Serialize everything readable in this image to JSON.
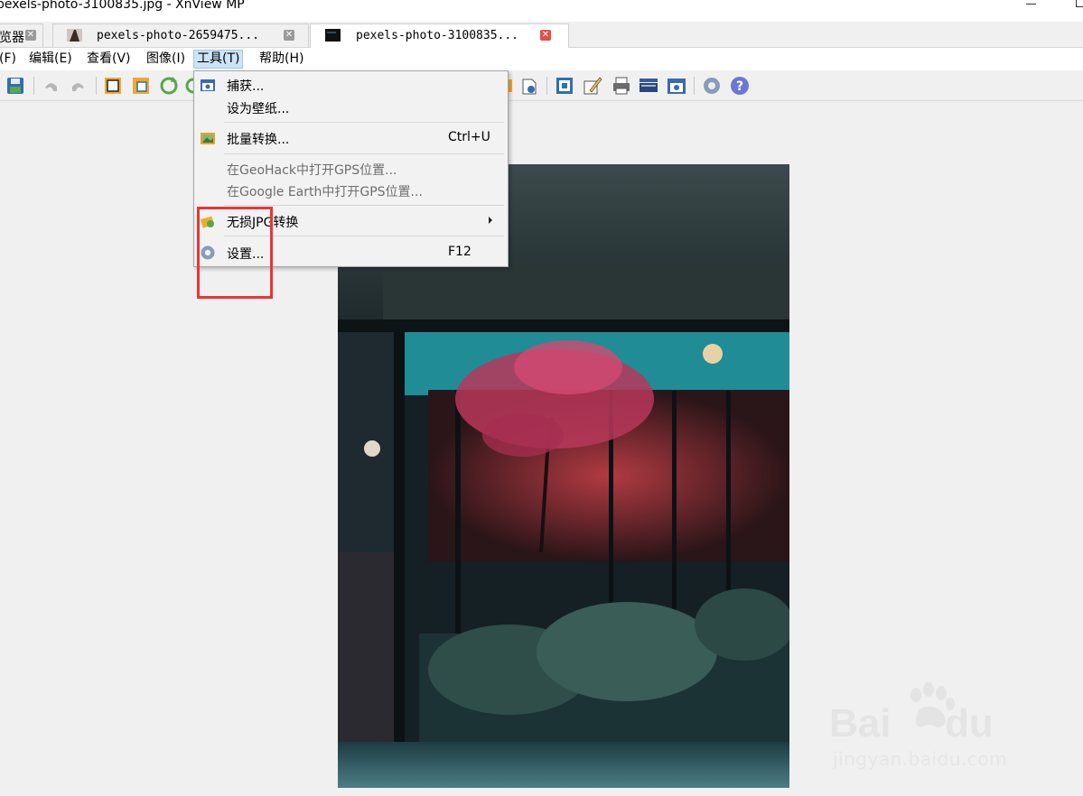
{
  "window": {
    "title": "pexels-photo-3100835.jpg - XnView MP"
  },
  "tabs": [
    {
      "label": "览器",
      "active": false
    },
    {
      "label": "pexels-photo-2659475...",
      "active": false
    },
    {
      "label": "pexels-photo-3100835...",
      "active": true
    }
  ],
  "menu": {
    "items": [
      "(F)",
      "编辑(E)",
      "查看(V)",
      "图像(I)",
      "工具(T)",
      "帮助(H)"
    ],
    "open_index": 4
  },
  "toolbar": {
    "icons": [
      "save-icon",
      "undo-icon",
      "redo-icon",
      "crop-icon",
      "resize-icon",
      "rotate-icon",
      "fit-window-icon",
      "edit-icon",
      "print-icon",
      "scanner-icon",
      "capture-icon",
      "settings-icon",
      "help-icon"
    ]
  },
  "tools_menu": {
    "capture": {
      "label": "捕获..."
    },
    "wallpaper": {
      "label": "设为壁纸..."
    },
    "batch": {
      "label": "批量转换...",
      "shortcut": "Ctrl+U"
    },
    "geohack": {
      "label": "在GeoHack中打开GPS位置..."
    },
    "google_earth": {
      "label": "在Google Earth中打开GPS位置..."
    },
    "lossless_jpg": {
      "label": "无损JPG转换"
    },
    "settings": {
      "label": "设置...",
      "shortcut": "F12"
    }
  },
  "watermark": {
    "text": "jingyan.baidu.com"
  },
  "colors": {
    "menu_highlight": "#cce4f7",
    "annotation_box": "#ee3333",
    "tab_close": "#e0504a"
  }
}
